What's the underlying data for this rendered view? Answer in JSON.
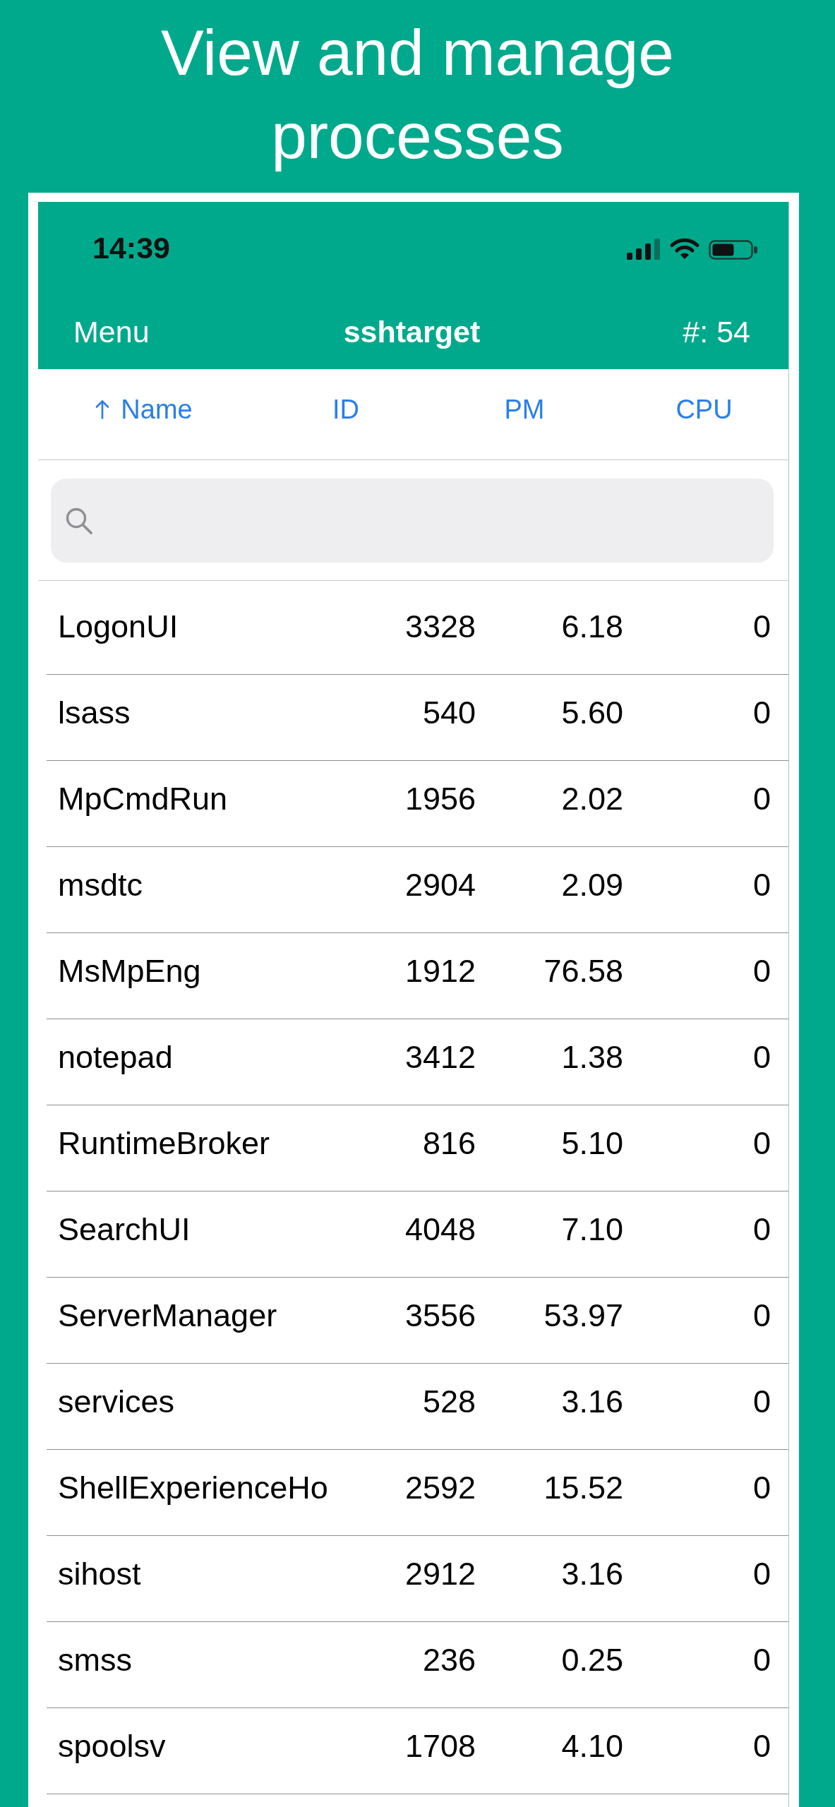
{
  "promo_title": "View and manage processes",
  "status_bar": {
    "time": "14:39"
  },
  "nav_bar": {
    "left_button": "Menu",
    "title": "sshtarget",
    "count": "#: 54"
  },
  "columns": [
    {
      "label": "Name",
      "sorted": true
    },
    {
      "label": "ID",
      "sorted": false
    },
    {
      "label": "PM",
      "sorted": false
    },
    {
      "label": "CPU",
      "sorted": false
    }
  ],
  "rows": [
    {
      "name": "LogonUI",
      "id": "3328",
      "pm": "6.18",
      "cpu": "0"
    },
    {
      "name": "lsass",
      "id": "540",
      "pm": "5.60",
      "cpu": "0"
    },
    {
      "name": "MpCmdRun",
      "id": "1956",
      "pm": "2.02",
      "cpu": "0"
    },
    {
      "name": "msdtc",
      "id": "2904",
      "pm": "2.09",
      "cpu": "0"
    },
    {
      "name": "MsMpEng",
      "id": "1912",
      "pm": "76.58",
      "cpu": "0"
    },
    {
      "name": "notepad",
      "id": "3412",
      "pm": "1.38",
      "cpu": "0"
    },
    {
      "name": "RuntimeBroker",
      "id": "816",
      "pm": "5.10",
      "cpu": "0"
    },
    {
      "name": "SearchUI",
      "id": "4048",
      "pm": "7.10",
      "cpu": "0"
    },
    {
      "name": "ServerManager",
      "id": "3556",
      "pm": "53.97",
      "cpu": "0"
    },
    {
      "name": "services",
      "id": "528",
      "pm": "3.16",
      "cpu": "0"
    },
    {
      "name": "ShellExperienceHo",
      "id": "2592",
      "pm": "15.52",
      "cpu": "0"
    },
    {
      "name": "sihost",
      "id": "2912",
      "pm": "3.16",
      "cpu": "0"
    },
    {
      "name": "smss",
      "id": "236",
      "pm": "0.25",
      "cpu": "0"
    },
    {
      "name": "spoolsv",
      "id": "1708",
      "pm": "4.10",
      "cpu": "0"
    }
  ]
}
